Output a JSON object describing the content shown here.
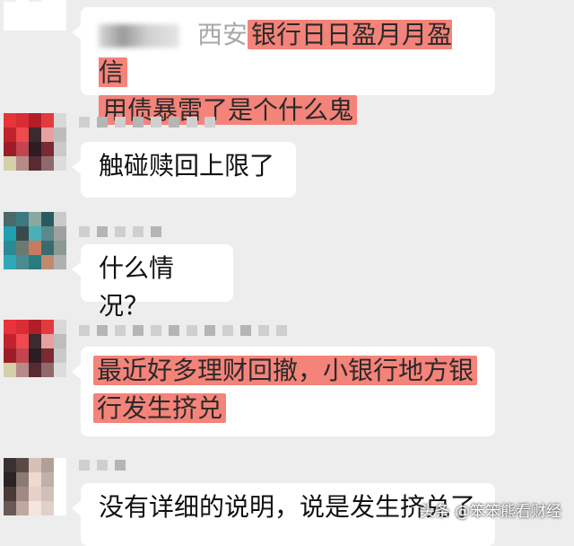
{
  "messages": [
    {
      "id": "m1",
      "sender_blurred_text": "西安",
      "text_line1": "银行日日盈月月盈信",
      "text_line2": "用债暴雷了是个什么鬼",
      "highlighted": true
    },
    {
      "id": "m2",
      "text_line1": "触碰赎回上限了",
      "highlighted": false
    },
    {
      "id": "m3",
      "text_line1": "什么情况？",
      "highlighted": false
    },
    {
      "id": "m4",
      "text_line1": "最近好多理财回撤，小银行地方银",
      "text_line2": "行发生挤兑",
      "highlighted": true
    },
    {
      "id": "m5",
      "text_line1": "没有详细的说明，说是发生挤兑了",
      "highlighted": false
    }
  ],
  "avatars": {
    "a1_colors": [
      "#ffffff",
      "#e8e8e8",
      "#5a4a4a",
      "#3a2a2a",
      "#ffffff",
      "#f0f0f0",
      "#ffffff",
      "#eeeeee",
      "#ffffff",
      "#ffffff",
      "#ffffff",
      "#ffffff",
      "#ffffff",
      "#ffffff",
      "#ffffff",
      "#ffffff",
      "#ffffff",
      "#ffffff",
      "#ffffff",
      "#ffffff"
    ],
    "a2_colors": [
      "#e8333a",
      "#d92d35",
      "#b11e28",
      "#e33a40",
      "#d8d8d8",
      "#c0232c",
      "#ef4a4f",
      "#3b2a2e",
      "#e8a0a0",
      "#bdbdbd",
      "#9c1d27",
      "#c4454e",
      "#2a1e22",
      "#7a2a33",
      "#c9c9c9",
      "#d4cfa8",
      "#b78a8a",
      "#5a2a32",
      "#8f6a6a",
      "#dcdcdc"
    ],
    "a3_colors": [
      "#4a6a6a",
      "#3a7a80",
      "#8aa8a0",
      "#2a5a60",
      "#c9c9c9",
      "#20a0b0",
      "#3a4a4a",
      "#4ab0b8",
      "#5a8a8a",
      "#a0a0a0",
      "#2a8a95",
      "#6a7a70",
      "#c87a60",
      "#3a6a70",
      "#8a9a90",
      "#30a8b5",
      "#4a8a90",
      "#2a7a80",
      "#c08a70",
      "#b0b0b0"
    ],
    "a4_colors": [
      "#e8333a",
      "#d92d35",
      "#b11e28",
      "#e33a40",
      "#d8d8d8",
      "#c0232c",
      "#ef4a4f",
      "#3b2a2e",
      "#e8a0a0",
      "#bdbdbd",
      "#9c1d27",
      "#c4454e",
      "#2a1e22",
      "#7a2a33",
      "#c9c9c9",
      "#d4cfa8",
      "#b78a8a",
      "#5a2a32",
      "#8f6a6a",
      "#dcdcdc"
    ],
    "a5_colors": [
      "#3a3030",
      "#5a4a45",
      "#d8c0b8",
      "#b0a09a",
      "#ffffff",
      "#2a2424",
      "#8a7a75",
      "#f0d8d0",
      "#c0b0aa",
      "#ffffff",
      "#4a3a38",
      "#a08a85",
      "#e8d0c8",
      "#d0c0ba",
      "#ffffff",
      "#6a5a55",
      "#c0a8a0",
      "#f5e5e0",
      "#e0d0ca",
      "#ffffff"
    ]
  },
  "watermark": "头条 @笨笨熊看财经"
}
